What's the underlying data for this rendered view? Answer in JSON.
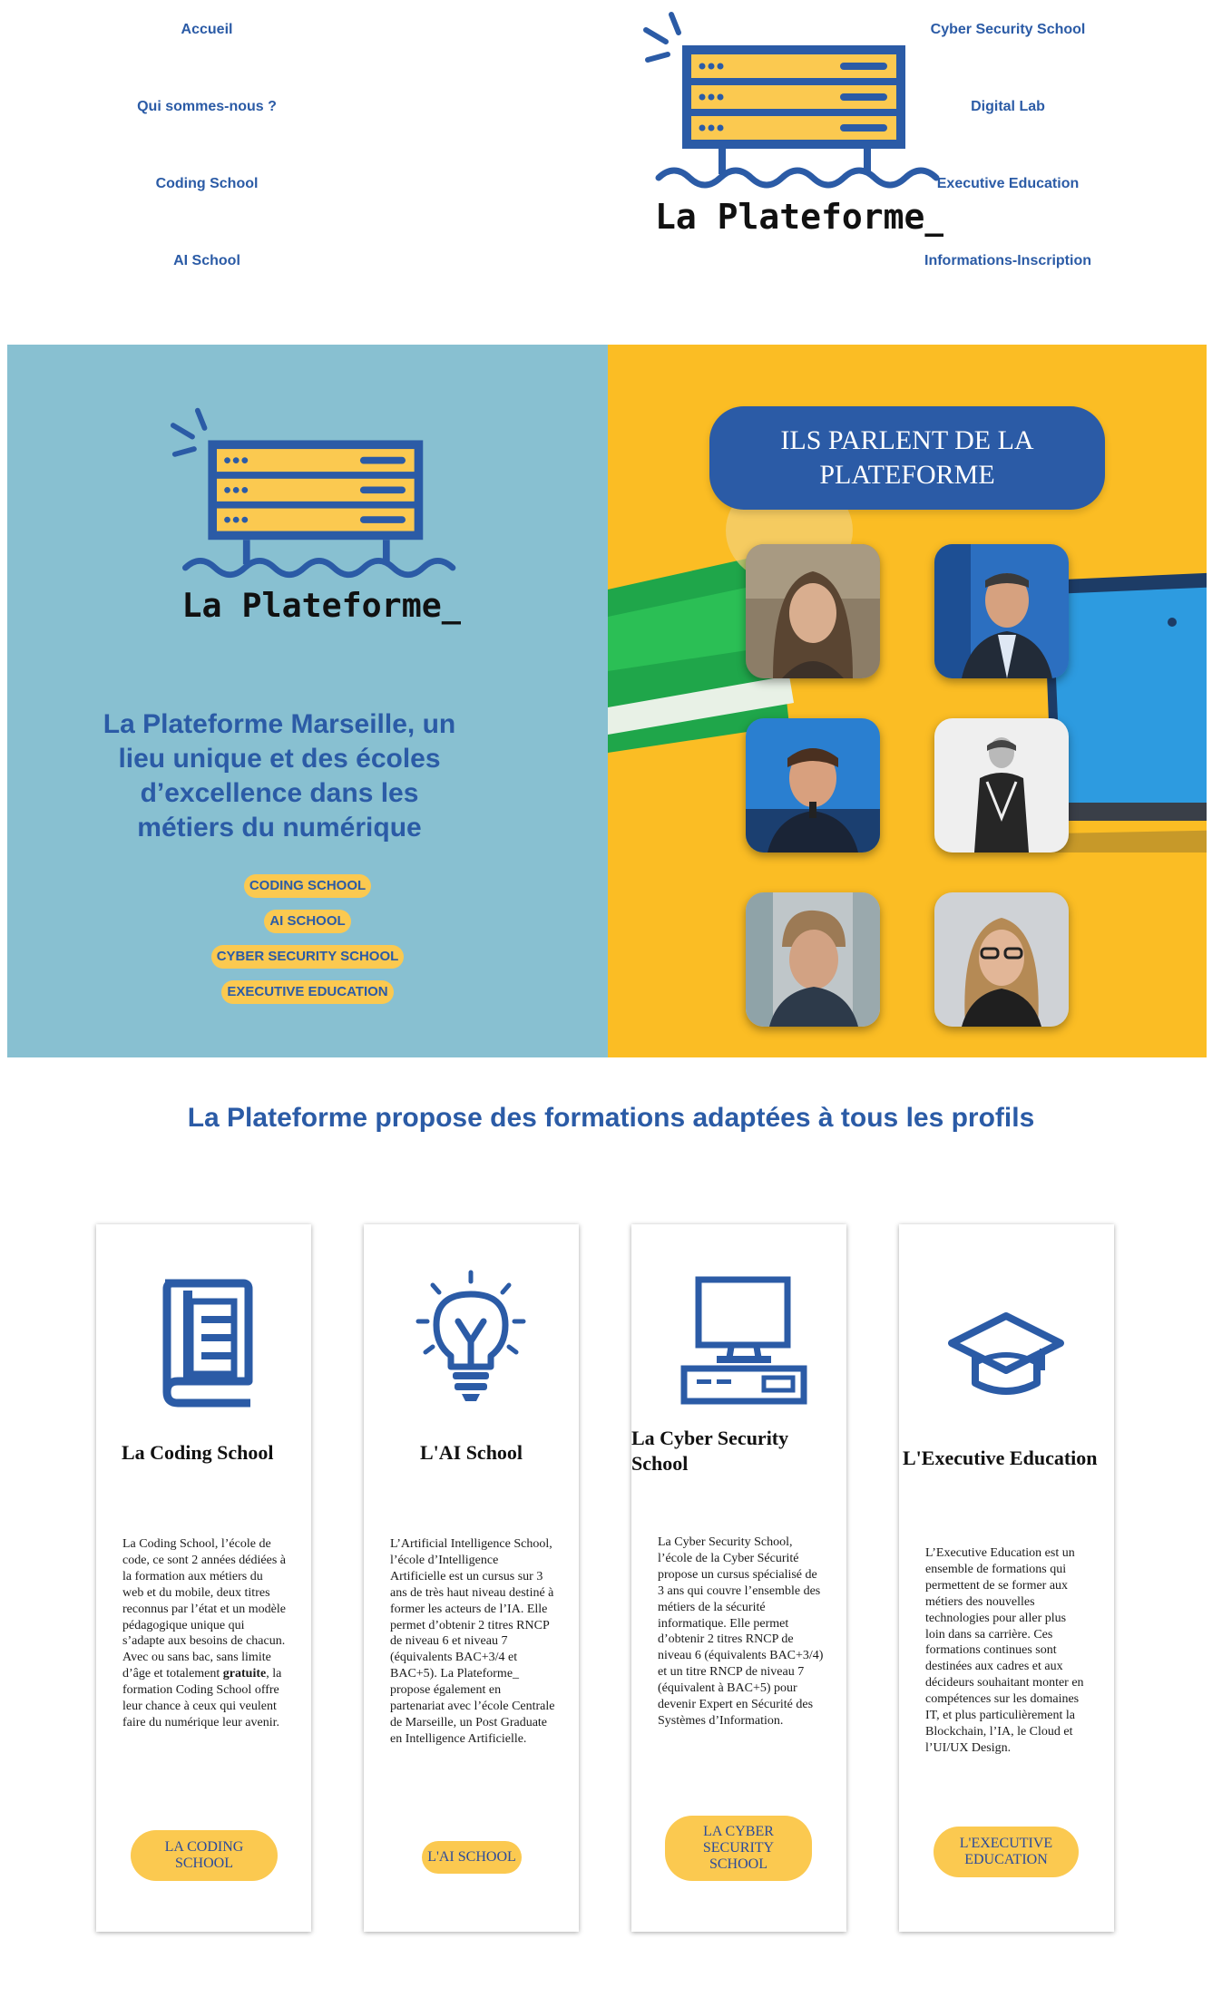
{
  "nav": {
    "left": [
      "Accueil",
      "Qui sommes-nous ?",
      "Coding School",
      "AI School"
    ],
    "right": [
      "Cyber Security School",
      "Digital Lab",
      "Executive Education",
      "Informations-Inscription"
    ]
  },
  "brand": {
    "logo_text": "La Plateforme_"
  },
  "colors": {
    "blue": "#2b5ba6",
    "yellow": "#fbc950",
    "sky": "#88c0d1",
    "amber": "#fbbd24"
  },
  "hero": {
    "title": "La Plateforme Marseille, un lieu unique et des écoles d’excellence dans les métiers du numérique",
    "pills": [
      "CODING SCHOOL",
      "AI SCHOOL",
      "CYBER SECURITY SCHOOL",
      "EXECUTIVE EDUCATION"
    ],
    "press_badge": "ILS PARLENT DE LA PLATEFORME"
  },
  "section": {
    "title": "La Plateforme propose des formations adaptées à tous les profils"
  },
  "cards": [
    {
      "icon": "book-icon",
      "title": "La Coding School",
      "text_parts": [
        "La Coding School, l’école de code, ce sont 2 années dédiées à la formation aux métiers du web et du mobile, deux titres reconnus par l’état et un modèle pédagogique unique qui s’adapte aux besoins de chacun. Avec ou sans bac, sans limite d’âge et totalement ",
        "gratuite",
        ", la formation Coding School offre leur chance à ceux qui veulent faire du numérique leur avenir."
      ],
      "button": "LA CODING SCHOOL"
    },
    {
      "icon": "lightbulb-icon",
      "title": "L'AI School",
      "text": "L’Artificial Intelligence School, l’école d’Intelligence Artificielle est un cursus sur 3 ans de très haut niveau destiné à former les acteurs de l’IA. Elle permet d’obtenir 2 titres RNCP de niveau 6 et niveau 7 (équivalents BAC+3/4 et BAC+5). La Plateforme_ propose également en partenariat avec l’école Centrale de Marseille, un Post Graduate en Intelligence Artificielle.",
      "button": "L'AI SCHOOL"
    },
    {
      "icon": "computer-icon",
      "title": "La Cyber Security School",
      "text": "La Cyber Security School, l’école de la Cyber Sécurité propose un cursus spécialisé de 3 ans qui couvre l’ensemble des métiers de la sécurité informatique. Elle permet d’obtenir 2 titres RNCP de niveau 6 (équivalents BAC+3/4) et un titre RNCP de niveau 7 (équivalent à BAC+5) pour devenir Expert en Sécurité des Systèmes d’Information.",
      "button": "LA CYBER SECURITY SCHOOL"
    },
    {
      "icon": "graduation-cap-icon",
      "title": "L'Executive Education",
      "text": "L’Executive Education est un ensemble de formations qui permettent de se former aux métiers des nouvelles technologies pour aller plus loin dans sa carrière. Ces formations continues sont destinées aux cadres et aux décideurs souhaitant monter en compétences sur les domaines IT, et plus particulièrement la Blockchain, l’IA, le Cloud et l’UI/UX Design.",
      "button": "L'EXECUTIVE EDUCATION"
    }
  ]
}
